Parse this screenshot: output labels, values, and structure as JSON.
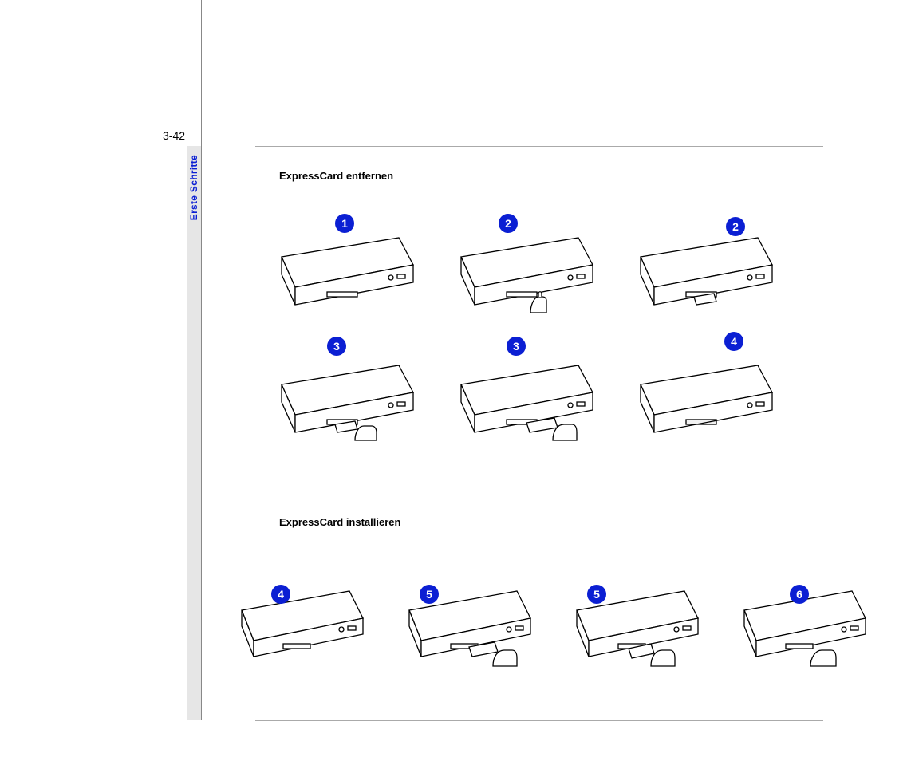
{
  "page_number": "3-42",
  "sidebar_label": "Erste Schritte",
  "section1_title": "ExpressCard entfernen",
  "section2_title": "ExpressCard installieren",
  "badge_color": "#0b1fd3",
  "grid1_badges": [
    "1",
    "2",
    "2",
    "3",
    "3",
    "4"
  ],
  "grid2_badges": [
    "4",
    "5",
    "5",
    "6"
  ]
}
